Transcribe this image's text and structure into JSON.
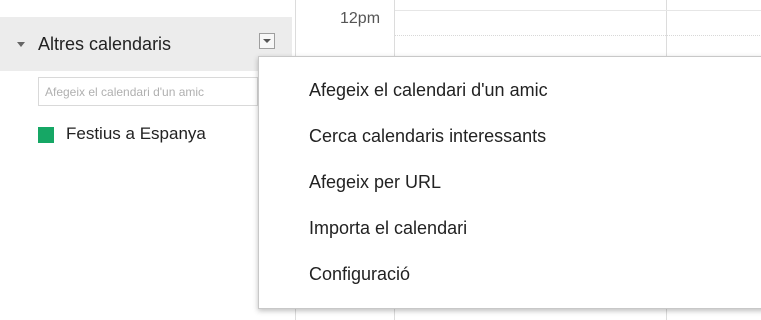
{
  "calendar_grid": {
    "time_label": "12pm"
  },
  "other_calendars": {
    "title": "Altres calendaris",
    "add_input": {
      "placeholder": "Afegeix el calendari d'un amic",
      "value": ""
    },
    "items": [
      {
        "label": "Festius a Espanya",
        "color": "#16a765"
      }
    ]
  },
  "menu": {
    "items": [
      {
        "label": "Afegeix el calendari d'un amic"
      },
      {
        "label": "Cerca calendaris interessants"
      },
      {
        "label": "Afegeix per URL"
      },
      {
        "label": "Importa el calendari"
      },
      {
        "label": "Configuració"
      }
    ]
  }
}
